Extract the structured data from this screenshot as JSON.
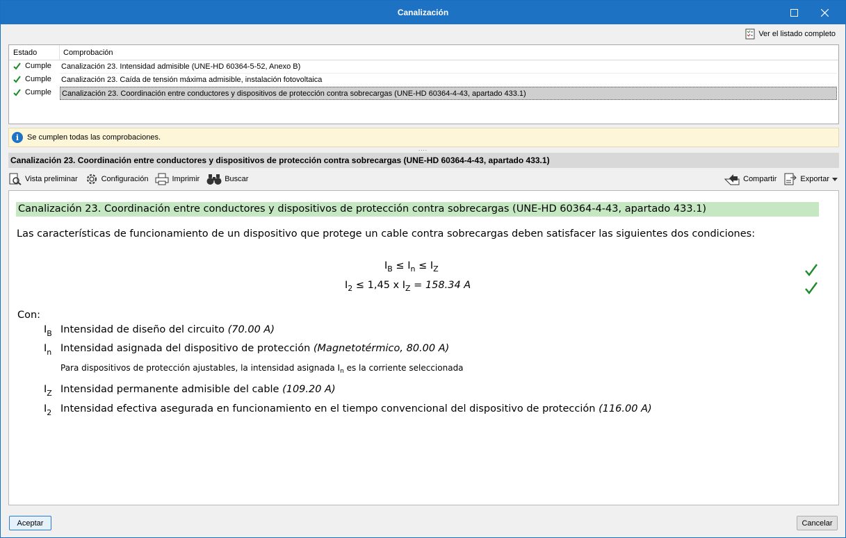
{
  "window": {
    "title": "Canalización"
  },
  "top_link": {
    "label": "Ver el listado completo",
    "icon": "checklist-icon"
  },
  "grid": {
    "columns": [
      "Estado",
      "Comprobación"
    ],
    "rows": [
      {
        "status": "Cumple",
        "text": "Canalización 23. Intensidad admisible (UNE-HD 60364-5-52, Anexo B)"
      },
      {
        "status": "Cumple",
        "text": "Canalización 23. Caída de tensión máxima admisible, instalación fotovoltaica"
      },
      {
        "status": "Cumple",
        "text": "Canalización 23. Coordinación entre conductores y dispositivos de protección contra sobrecargas (UNE-HD 60364-4-43, apartado 433.1)",
        "selected": true
      }
    ]
  },
  "info": {
    "message": "Se cumplen todas las comprobaciones."
  },
  "section": {
    "title": "Canalización 23. Coordinación entre conductores y dispositivos de protección contra sobrecargas (UNE-HD 60364-4-43, apartado 433.1)"
  },
  "toolbar": {
    "preview": "Vista preliminar",
    "config": "Configuración",
    "print": "Imprimir",
    "search": "Buscar",
    "share": "Compartir",
    "export": "Exportar"
  },
  "report": {
    "heading": "Canalización 23. Coordinación entre conductores y dispositivos de protección contra sobrecargas (UNE-HD 60364-4-43, apartado 433.1)",
    "intro": "Las características de funcionamiento de un dispositivo que protege un cable contra sobrecargas deben satisfacer las siguientes dos condiciones:",
    "formula2_value": "158.34 A",
    "con_label": "Con:",
    "variables": [
      {
        "desc": "Intensidad de diseño del circuito",
        "value": "(70.00 A)"
      },
      {
        "desc": "Intensidad asignada del dispositivo de protección",
        "value": "(Magnetotérmico, 80.00 A)"
      },
      {
        "desc": "Intensidad permanente admisible del cable",
        "value": "(109.20 A)"
      },
      {
        "desc": "Intensidad efectiva asegurada en funcionamiento en el tiempo convencional del dispositivo de protección",
        "value": "(116.00 A)"
      }
    ],
    "note_prefix": "Para dispositivos de protección ajustables, la intensidad asignada",
    "note_suffix": "es la corriente seleccionada"
  },
  "buttons": {
    "accept": "Aceptar",
    "cancel": "Cancelar"
  },
  "colors": {
    "titlebar": "#1d72c4",
    "check": "#1e8a2a",
    "heading_bg": "#c5e8c3",
    "info_bg": "#fdf6d8"
  }
}
